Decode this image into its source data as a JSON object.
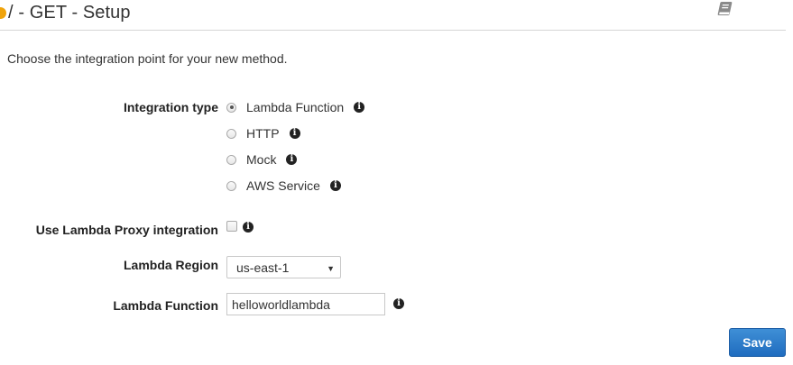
{
  "header": {
    "title": "/ - GET - Setup"
  },
  "subtitle": "Choose the integration point for your new method.",
  "integration_type": {
    "label": "Integration type",
    "options": [
      {
        "label": "Lambda Function",
        "selected": true
      },
      {
        "label": "HTTP",
        "selected": false
      },
      {
        "label": "Mock",
        "selected": false
      },
      {
        "label": "AWS Service",
        "selected": false
      }
    ]
  },
  "proxy": {
    "label": "Use Lambda Proxy integration",
    "checked": false
  },
  "region": {
    "label": "Lambda Region",
    "value": "us-east-1"
  },
  "function": {
    "label": "Lambda Function",
    "value": "helloworldlambda"
  },
  "info_glyph": "i",
  "actions": {
    "save_label": "Save"
  },
  "colors": {
    "accent": "#1f6cbf",
    "status_dot": "#f0a30a"
  },
  "icons": [
    "status-dot-icon",
    "documentation-book-icon",
    "info-icon",
    "dropdown-arrow-icon"
  ]
}
